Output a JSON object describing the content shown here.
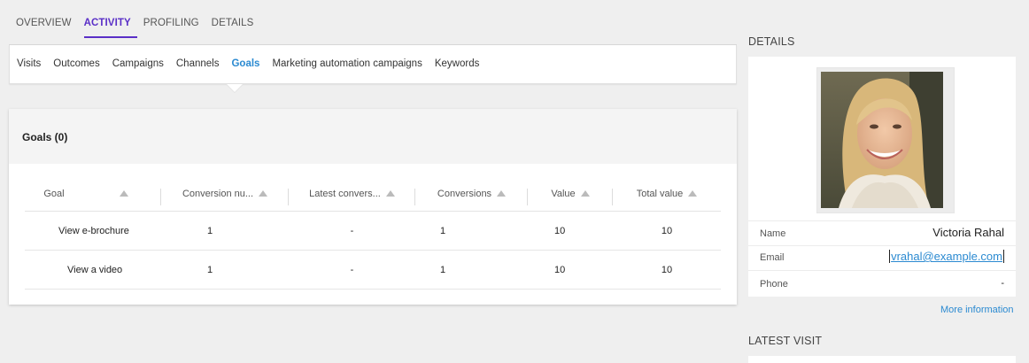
{
  "top_tabs": [
    {
      "label": "OVERVIEW",
      "active": false
    },
    {
      "label": "ACTIVITY",
      "active": true
    },
    {
      "label": "PROFILING",
      "active": false
    },
    {
      "label": "DETAILS",
      "active": false
    }
  ],
  "sub_tabs": [
    "Visits",
    "Outcomes",
    "Campaigns",
    "Channels",
    "Goals",
    "Marketing automation campaigns",
    "Keywords"
  ],
  "sub_tab_active": "Goals",
  "goals_panel": {
    "title": "Goals (0)",
    "columns": [
      "Goal",
      "Conversion nu...",
      "Latest convers...",
      "Conversions",
      "Value",
      "Total value"
    ],
    "rows": [
      [
        "View e-brochure",
        "1",
        "-",
        "1",
        "10",
        "10"
      ],
      [
        "View a video",
        "1",
        "-",
        "1",
        "10",
        "10"
      ]
    ]
  },
  "details": {
    "title": "DETAILS",
    "name_label": "Name",
    "name_value": "Victoria Rahal",
    "email_label": "Email",
    "email_value": "vrahal@example.com",
    "phone_label": "Phone",
    "phone_value": "-",
    "more_link": "More information"
  },
  "latest_visit": {
    "title": "LATEST VISIT"
  },
  "colors": {
    "accent_purple": "#5a2fc7",
    "link_blue": "#2b8ad1"
  }
}
